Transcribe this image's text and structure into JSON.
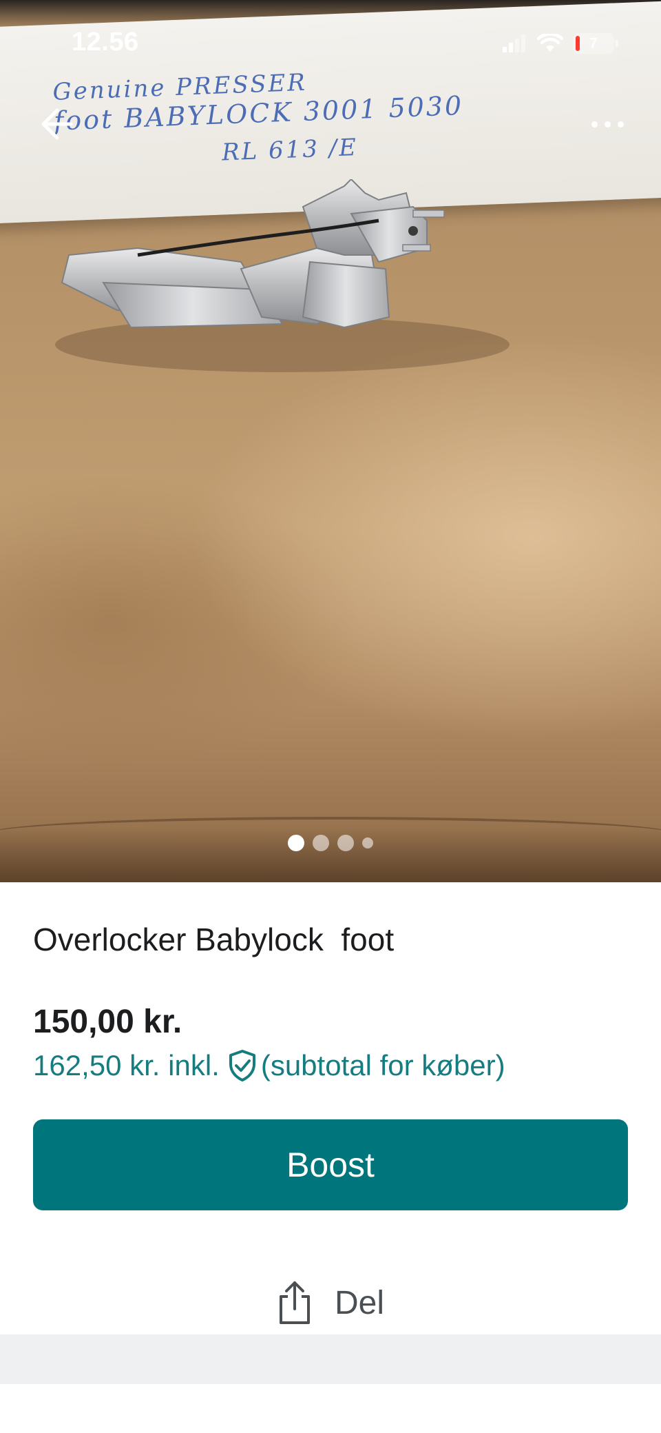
{
  "status_bar": {
    "time": "12.56",
    "battery_level": "7",
    "icons": [
      "signal-icon",
      "wifi-icon",
      "battery-icon"
    ]
  },
  "photo": {
    "handwritten_note": [
      "Genuine PRESSER",
      "foot BABYLOCK 3001 5030",
      "RL 613 /E"
    ],
    "pager": {
      "count": 4,
      "active_index": 0
    }
  },
  "overlay": {
    "back_icon": "arrow-left-icon",
    "more_icon": "more-dots-icon"
  },
  "listing": {
    "title": "Overlocker Babylock  foot",
    "price": "150,00 kr.",
    "buyer_price": "162,50 kr. inkl.",
    "buyer_note": "(subtotal for køber)",
    "shield_icon": "shield-check-icon"
  },
  "actions": {
    "boost_label": "Boost",
    "share_label": "Del",
    "share_icon": "share-icon"
  },
  "colors": {
    "accent": "#00767c",
    "link": "#157c80",
    "text": "#1b1d1f",
    "muted": "#4a4f54",
    "band": "#eef0f1"
  }
}
